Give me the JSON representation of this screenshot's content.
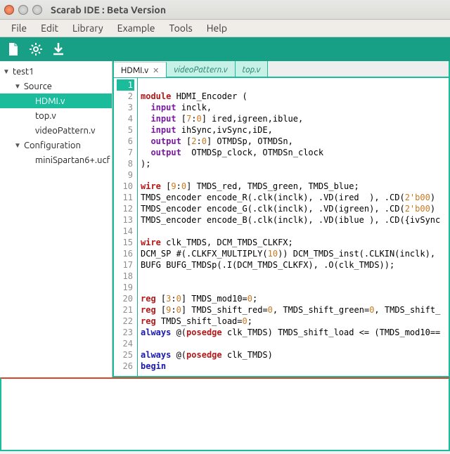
{
  "window": {
    "title": "Scarab IDE : Beta Version"
  },
  "menubar": [
    "File",
    "Edit",
    "Library",
    "Example",
    "Tools",
    "Help"
  ],
  "toolbar_icons": [
    "new-file-icon",
    "gear-icon",
    "download-icon"
  ],
  "tree": {
    "root": {
      "label": "test1",
      "expanded": true
    },
    "groups": [
      {
        "label": "Source",
        "expanded": true,
        "items": [
          {
            "label": "HDMI.v",
            "selected": true
          },
          {
            "label": "top.v",
            "selected": false
          },
          {
            "label": "videoPattern.v",
            "selected": false
          }
        ]
      },
      {
        "label": "Configuration",
        "expanded": true,
        "items": [
          {
            "label": "miniSpartan6+.ucf",
            "selected": false
          }
        ]
      }
    ]
  },
  "tabs": [
    {
      "label": "HDMI.v",
      "active": true,
      "dirty": true
    },
    {
      "label": "videoPattern.v",
      "active": false,
      "dirty": false
    },
    {
      "label": "top.v",
      "active": false,
      "dirty": false
    }
  ],
  "code_lines": [
    {
      "n": 1,
      "current": true,
      "html": ""
    },
    {
      "n": 2,
      "html": "<span class='kw'>module</span> <span class='id'>HDMI_Encoder</span> ("
    },
    {
      "n": 3,
      "html": "  <span class='typ'>input</span> inclk,"
    },
    {
      "n": 4,
      "html": "  <span class='typ'>input</span> [<span class='rng'>7</span>:<span class='rng'>0</span>] ired,igreen,iblue,"
    },
    {
      "n": 5,
      "html": "  <span class='typ'>input</span> ihSync,ivSync,iDE,"
    },
    {
      "n": 6,
      "html": "  <span class='typ'>output</span> [<span class='rng'>2</span>:<span class='rng'>0</span>] OTMDSp, OTMDSn,"
    },
    {
      "n": 7,
      "html": "  <span class='typ'>output</span>  OTMDSp_clock, OTMDSn_clock"
    },
    {
      "n": 8,
      "html": ");"
    },
    {
      "n": 9,
      "html": ""
    },
    {
      "n": 10,
      "html": "<span class='kw'>wire</span> [<span class='rng'>9</span>:<span class='rng'>0</span>] TMDS_red, TMDS_green, TMDS_blue;"
    },
    {
      "n": 11,
      "html": "TMDS_encoder encode_R(.clk(inclk), .VD(ired  ), .CD(<span class='num'>2'b00</span>)"
    },
    {
      "n": 12,
      "html": "TMDS_encoder encode_G(.clk(inclk), .VD(igreen), .CD(<span class='num'>2'b00</span>)"
    },
    {
      "n": 13,
      "html": "TMDS_encoder encode_B(.clk(inclk), .VD(iblue ), .CD({ivSync"
    },
    {
      "n": 14,
      "html": ""
    },
    {
      "n": 15,
      "html": "<span class='kw'>wire</span> clk_TMDS, DCM_TMDS_CLKFX;"
    },
    {
      "n": 16,
      "html": "DCM_SP #(.CLKFX_MULTIPLY(<span class='num'>10</span>)) DCM_TMDS_inst(.CLKIN(inclk),"
    },
    {
      "n": 17,
      "html": "BUFG BUFG_TMDSp(.I(DCM_TMDS_CLKFX), .O(clk_TMDS));"
    },
    {
      "n": 18,
      "html": ""
    },
    {
      "n": 19,
      "html": ""
    },
    {
      "n": 20,
      "html": "<span class='kw'>reg</span> [<span class='rng'>3</span>:<span class='rng'>0</span>] TMDS_mod10=<span class='num'>0</span>;"
    },
    {
      "n": 21,
      "html": "<span class='kw'>reg</span> [<span class='rng'>9</span>:<span class='rng'>0</span>] TMDS_shift_red=<span class='num'>0</span>, TMDS_shift_green=<span class='num'>0</span>, TMDS_shift_"
    },
    {
      "n": 22,
      "html": "<span class='kw'>reg</span> TMDS_shift_load=<span class='num'>0</span>;"
    },
    {
      "n": 23,
      "html": "<span class='kw2'>always</span> @(<span class='kw'>posedge</span> clk_TMDS) TMDS_shift_load &lt;= (TMDS_mod10=="
    },
    {
      "n": 24,
      "html": ""
    },
    {
      "n": 25,
      "html": "<span class='kw2'>always</span> @(<span class='kw'>posedge</span> clk_TMDS)"
    },
    {
      "n": 26,
      "html": "<span class='kw2'>begin</span>"
    }
  ]
}
